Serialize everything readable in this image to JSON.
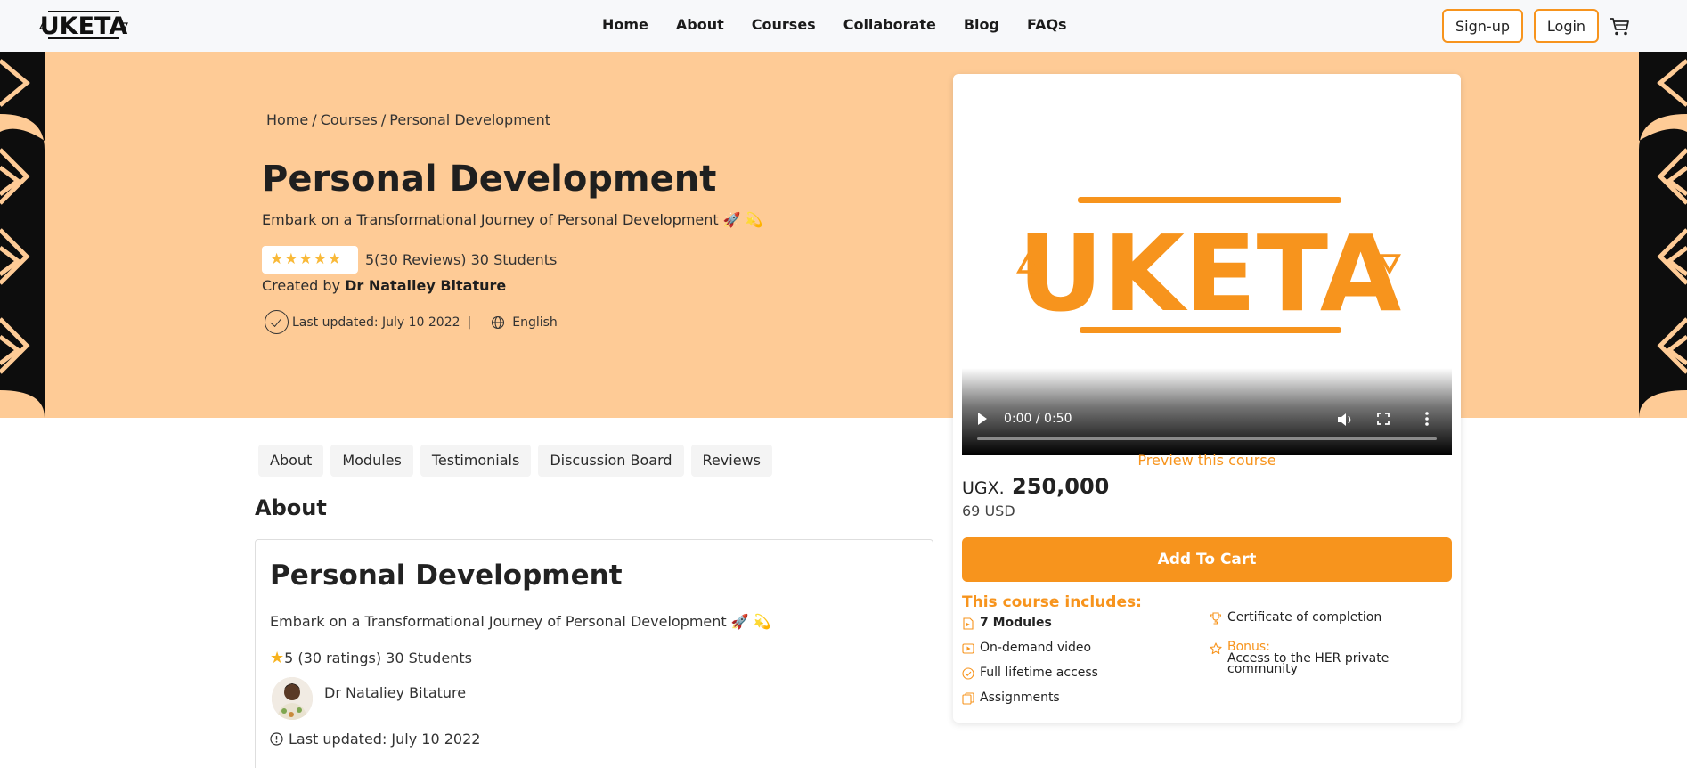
{
  "nav": {
    "logo_text": "UKETA",
    "links": [
      "Home",
      "About",
      "Courses",
      "Collaborate",
      "Blog",
      "FAQs"
    ],
    "signup_label": "Sign-up",
    "login_label": "Login"
  },
  "hero": {
    "breadcrumb": [
      "Home",
      "/",
      "Courses",
      "/",
      "Personal Development"
    ],
    "title": "Personal Development",
    "subtitle": "Embark on a Transformational Journey of Personal Development 🚀 💫",
    "stars": "★★★★★",
    "rating_text": "5(30 Reviews) 30 Students",
    "created_by_label": "Created by",
    "author": "Dr Nataliey Bitature",
    "last_updated": "Last updated: July 10 2022",
    "separator": "|",
    "language": "English"
  },
  "card": {
    "video_logo_text": "UKETA",
    "video_time": "0:00 / 0:50",
    "video_progress": 0,
    "preview_label": "Preview this course",
    "price_currency": "UGX.",
    "price_value": "250,000",
    "price_usd": "69 USD",
    "add_to_cart_label": "Add To Cart",
    "includes_title": "This course includes:",
    "includes_left": [
      {
        "text": "7 Modules",
        "bold": true,
        "icon": "file-icon"
      },
      {
        "text": "On-demand video",
        "bold": false,
        "icon": "video-icon"
      },
      {
        "text": "Full lifetime access",
        "bold": false,
        "icon": "check-circle-icon"
      },
      {
        "text": "Assignments",
        "bold": false,
        "icon": "copy-icon"
      }
    ],
    "certificate": "Certificate of completion",
    "bonus_label": "Bonus:",
    "bonus_text": "Access to the HER private community"
  },
  "tabs": [
    "About",
    "Modules",
    "Testimonials",
    "Discussion Board",
    "Reviews"
  ],
  "about": {
    "heading": "About",
    "title": "Personal Development",
    "subtitle": "Embark on a Transformational Journey of Personal Development 🚀 💫",
    "star": "★",
    "rating": "5 (30 ratings) 30 Students",
    "author": "Dr Nataliey Bitature",
    "last_updated": "Last updated: July 10 2022"
  },
  "colors": {
    "accent": "#f7941d",
    "hero_bg": "#fecb96",
    "star": "#f9b938"
  }
}
